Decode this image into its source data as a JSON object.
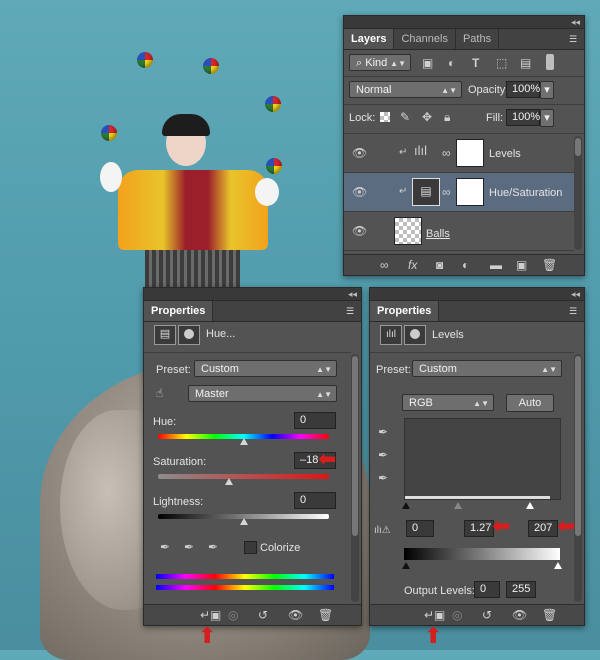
{
  "layers_panel": {
    "tabs": [
      "Layers",
      "Channels",
      "Paths"
    ],
    "kind_label": "Kind",
    "blend_mode": "Normal",
    "opacity_label": "Opacity:",
    "opacity_value": "100%",
    "lock_label": "Lock:",
    "fill_label": "Fill:",
    "fill_value": "100%",
    "layers": [
      {
        "name": "Levels",
        "selected": false
      },
      {
        "name": "Hue/Saturation",
        "selected": true
      },
      {
        "name": "Balls",
        "selected": false
      }
    ]
  },
  "hue_panel": {
    "tab": "Properties",
    "title": "Hue...",
    "preset_label": "Preset:",
    "preset_value": "Custom",
    "channel_value": "Master",
    "hue_label": "Hue:",
    "hue_value": "0",
    "saturation_label": "Saturation:",
    "saturation_value": "–18",
    "lightness_label": "Lightness:",
    "lightness_value": "0",
    "colorize_label": "Colorize"
  },
  "levels_panel": {
    "tab": "Properties",
    "title": "Levels",
    "preset_label": "Preset:",
    "preset_value": "Custom",
    "channel_value": "RGB",
    "auto_label": "Auto",
    "input_black": "0",
    "input_mid": "1.27",
    "input_white": "207",
    "output_label": "Output Levels:",
    "output_black": "0",
    "output_white": "255"
  },
  "colors": {
    "selection": "#5b6c80",
    "panel": "#535353",
    "annotation_arrow": "#d51f1f"
  }
}
